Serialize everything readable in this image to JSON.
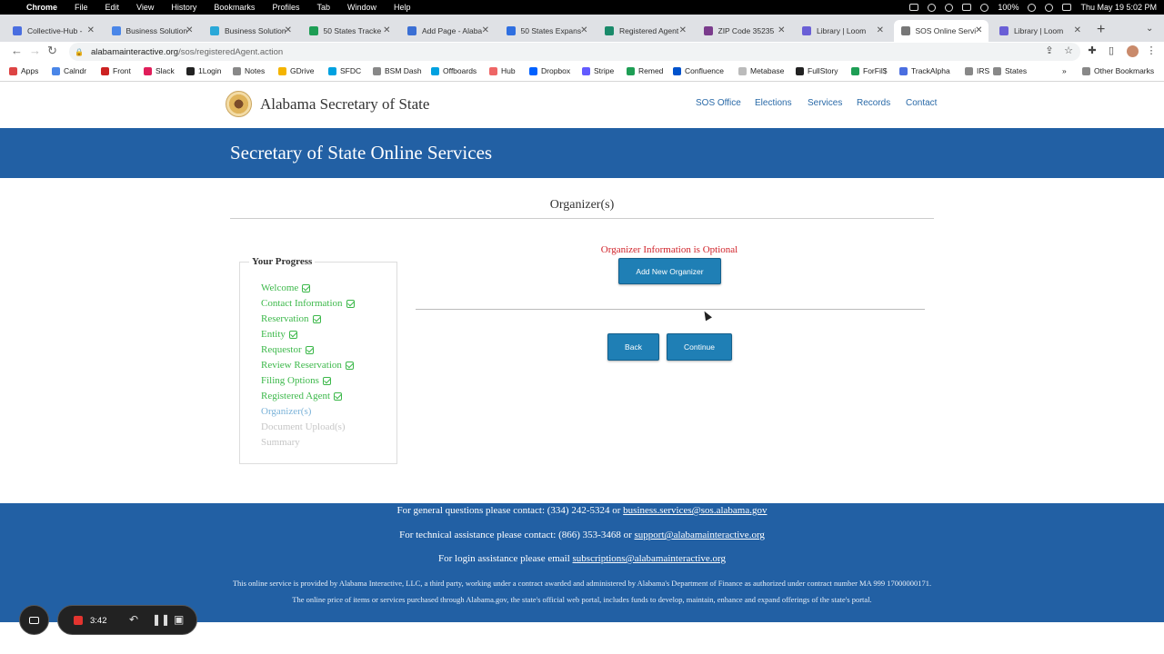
{
  "mac_menu": {
    "app": "Chrome",
    "items": [
      "File",
      "Edit",
      "View",
      "History",
      "Bookmarks",
      "Profiles",
      "Tab",
      "Window",
      "Help"
    ],
    "battery": "100%",
    "clock": "Thu May 19  5:02 PM"
  },
  "tabs": [
    {
      "title": "Collective-Hub -",
      "color": "#4a6ee0"
    },
    {
      "title": "Business Solution",
      "color": "#4a86e8"
    },
    {
      "title": "Business Solution",
      "color": "#2aa8d8"
    },
    {
      "title": "50 States Tracke",
      "color": "#1e9e55"
    },
    {
      "title": "Add Page - Alaba",
      "color": "#3b6fd4"
    },
    {
      "title": "50 States Expans",
      "color": "#2f6fe0"
    },
    {
      "title": "Registered Agent",
      "color": "#1a8a6a"
    },
    {
      "title": "ZIP Code 35235",
      "color": "#7a3b8c"
    },
    {
      "title": "Library | Loom",
      "color": "#6a5fd6"
    },
    {
      "title": "SOS Online Servi",
      "color": "#777777"
    },
    {
      "title": "Library | Loom",
      "color": "#6a5fd6"
    }
  ],
  "address_bar": {
    "host": "alabamainteractive.org",
    "path": "/sos/registeredAgent.action"
  },
  "bookmarks": [
    {
      "label": "Apps",
      "color": "#d44"
    },
    {
      "label": "Calndr",
      "color": "#4a86e8"
    },
    {
      "label": "Front",
      "color": "#c22"
    },
    {
      "label": "Slack",
      "color": "#e01e5a"
    },
    {
      "label": "1Login",
      "color": "#222"
    },
    {
      "label": "Notes",
      "color": "#888"
    },
    {
      "label": "GDrive",
      "color": "#f4b400"
    },
    {
      "label": "SFDC",
      "color": "#00a1e0"
    },
    {
      "label": "BSM Dash",
      "color": "#888"
    },
    {
      "label": "Offboards",
      "color": "#00a1e0"
    },
    {
      "label": "Hub",
      "color": "#e66"
    },
    {
      "label": "Dropbox",
      "color": "#0061ff"
    },
    {
      "label": "Stripe",
      "color": "#635bff"
    },
    {
      "label": "Remed",
      "color": "#1e9e55"
    },
    {
      "label": "Confluence",
      "color": "#0052cc"
    },
    {
      "label": "Metabase",
      "color": "#bbb"
    },
    {
      "label": "FullStory",
      "color": "#222"
    },
    {
      "label": "ForFil$",
      "color": "#1e9e55"
    },
    {
      "label": "TrackAlpha",
      "color": "#4a6ee0"
    },
    {
      "label": "IRS",
      "color": "#888"
    },
    {
      "label": "States",
      "color": "#888"
    }
  ],
  "other_bookmarks": "Other Bookmarks",
  "site": {
    "title": "Alabama Secretary of State",
    "nav": [
      "SOS Office",
      "Elections",
      "Services",
      "Records",
      "Contact"
    ],
    "banner": "Secretary of State Online Services"
  },
  "page_title": "Organizer(s)",
  "progress": {
    "legend": "Your Progress",
    "steps": [
      {
        "label": "Welcome",
        "state": "done"
      },
      {
        "label": "Contact Information",
        "state": "done"
      },
      {
        "label": "Reservation",
        "state": "done"
      },
      {
        "label": "Entity",
        "state": "done"
      },
      {
        "label": "Requestor",
        "state": "done"
      },
      {
        "label": "Review Reservation",
        "state": "done"
      },
      {
        "label": "Filing Options",
        "state": "done"
      },
      {
        "label": "Registered Agent",
        "state": "done"
      },
      {
        "label": "Organizer(s)",
        "state": "current"
      },
      {
        "label": "Document Upload(s)",
        "state": "future"
      },
      {
        "label": "Summary",
        "state": "future"
      }
    ]
  },
  "main": {
    "optional_note": "Organizer Information is Optional",
    "add_button": "Add New Organizer",
    "back_button": "Back",
    "continue_button": "Continue"
  },
  "footer": {
    "general_prefix": "For general questions please contact: (334) 242-5324 or ",
    "general_email": "business.services@sos.alabama.gov",
    "tech_prefix": "For technical assistance please contact: (866) 353-3468 or ",
    "tech_email": "support@alabamainteractive.org",
    "login_prefix": "For login assistance please email ",
    "login_email": "subscriptions@alabamainteractive.org",
    "disclaimer": "This online service is provided by Alabama Interactive, LLC, a third party, working under a contract awarded and administered by Alabama's Department of Finance as authorized under contract number MA 999 17000000171. The online price of items or services purchased through Alabama.gov, the state's official web portal, includes funds to develop, maintain, enhance and expand offerings of the state's portal."
  },
  "recorder": {
    "time": "3:42"
  },
  "colors": {
    "brand_blue": "#2260a4",
    "button_blue": "#1f7fb5",
    "done_green": "#3cb84a",
    "warning_red": "#d1232a"
  }
}
